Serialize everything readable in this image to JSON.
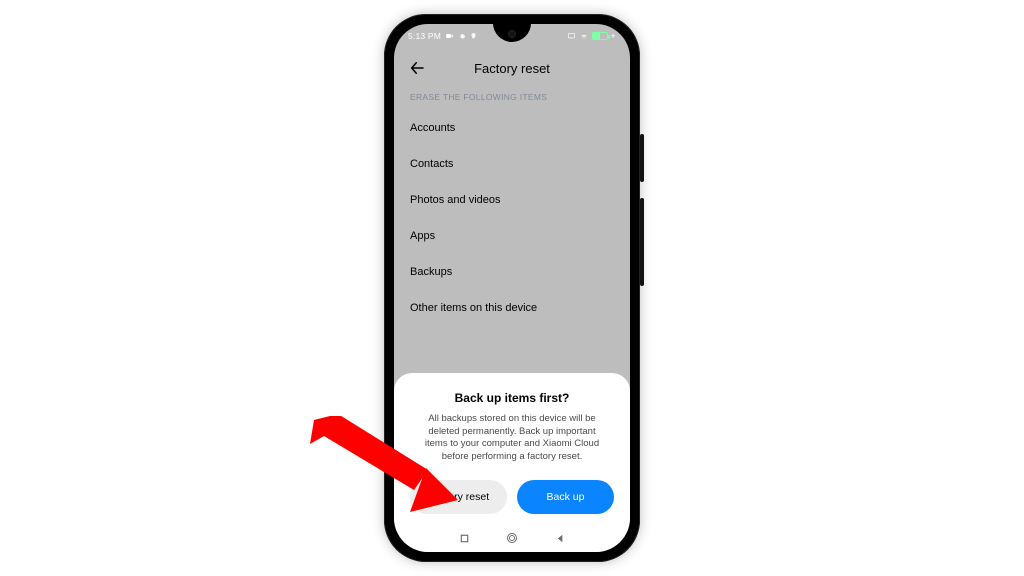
{
  "statusbar": {
    "time": "5:13 PM",
    "charge_glyph": "+"
  },
  "header": {
    "title": "Factory reset"
  },
  "section_label": "ERASE THE FOLLOWING ITEMS",
  "items": [
    "Accounts",
    "Contacts",
    "Photos and videos",
    "Apps",
    "Backups",
    "Other items on this device"
  ],
  "sheet": {
    "title": "Back up items first?",
    "body": "All backups stored on this device will be deleted permanently. Back up important items to your computer and Xiaomi Cloud before performing a factory reset.",
    "secondary_label": "Factory reset",
    "primary_label": "Back up"
  }
}
